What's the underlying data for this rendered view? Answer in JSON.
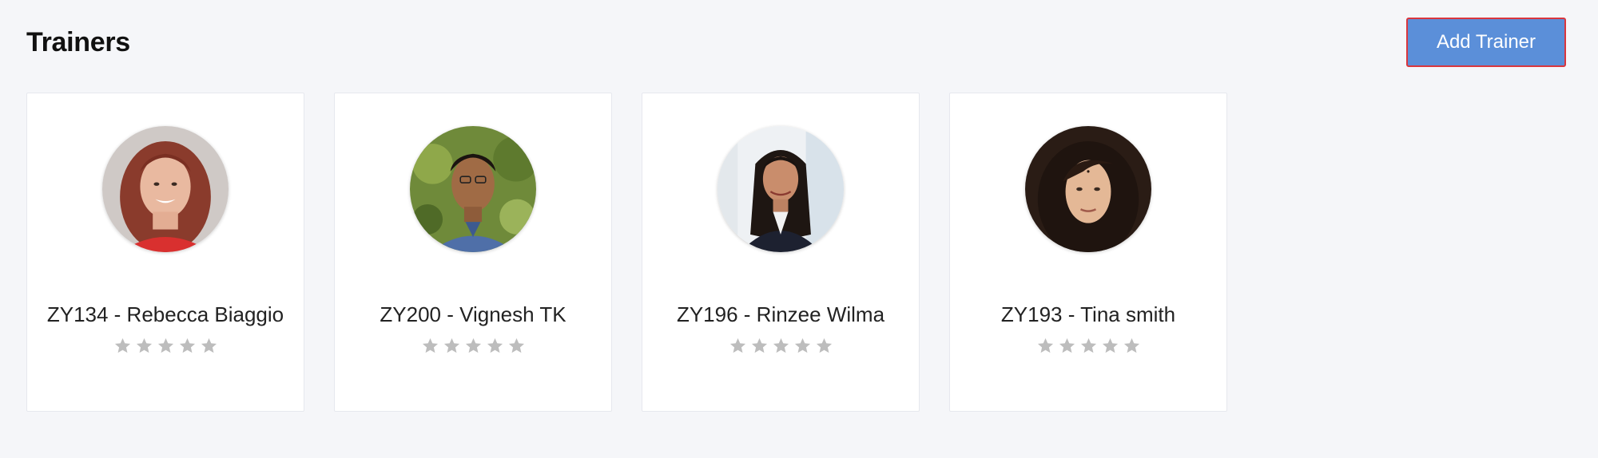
{
  "page": {
    "title": "Trainers",
    "add_button_label": "Add Trainer"
  },
  "colors": {
    "background": "#f5f6f9",
    "primary_button": "#5b8fd9",
    "button_outline": "#d9363e",
    "star": "#bdbdbd"
  },
  "trainers": [
    {
      "label": "ZY134 - Rebecca Biaggio",
      "rating": 0,
      "max_rating": 5,
      "avatar": "avatar-photo-rebecca"
    },
    {
      "label": "ZY200 - Vignesh TK",
      "rating": 0,
      "max_rating": 5,
      "avatar": "avatar-photo-vignesh"
    },
    {
      "label": "ZY196 - Rinzee Wilma",
      "rating": 0,
      "max_rating": 5,
      "avatar": "avatar-photo-rinzee"
    },
    {
      "label": "ZY193 - Tina smith",
      "rating": 0,
      "max_rating": 5,
      "avatar": "avatar-photo-tina"
    }
  ]
}
